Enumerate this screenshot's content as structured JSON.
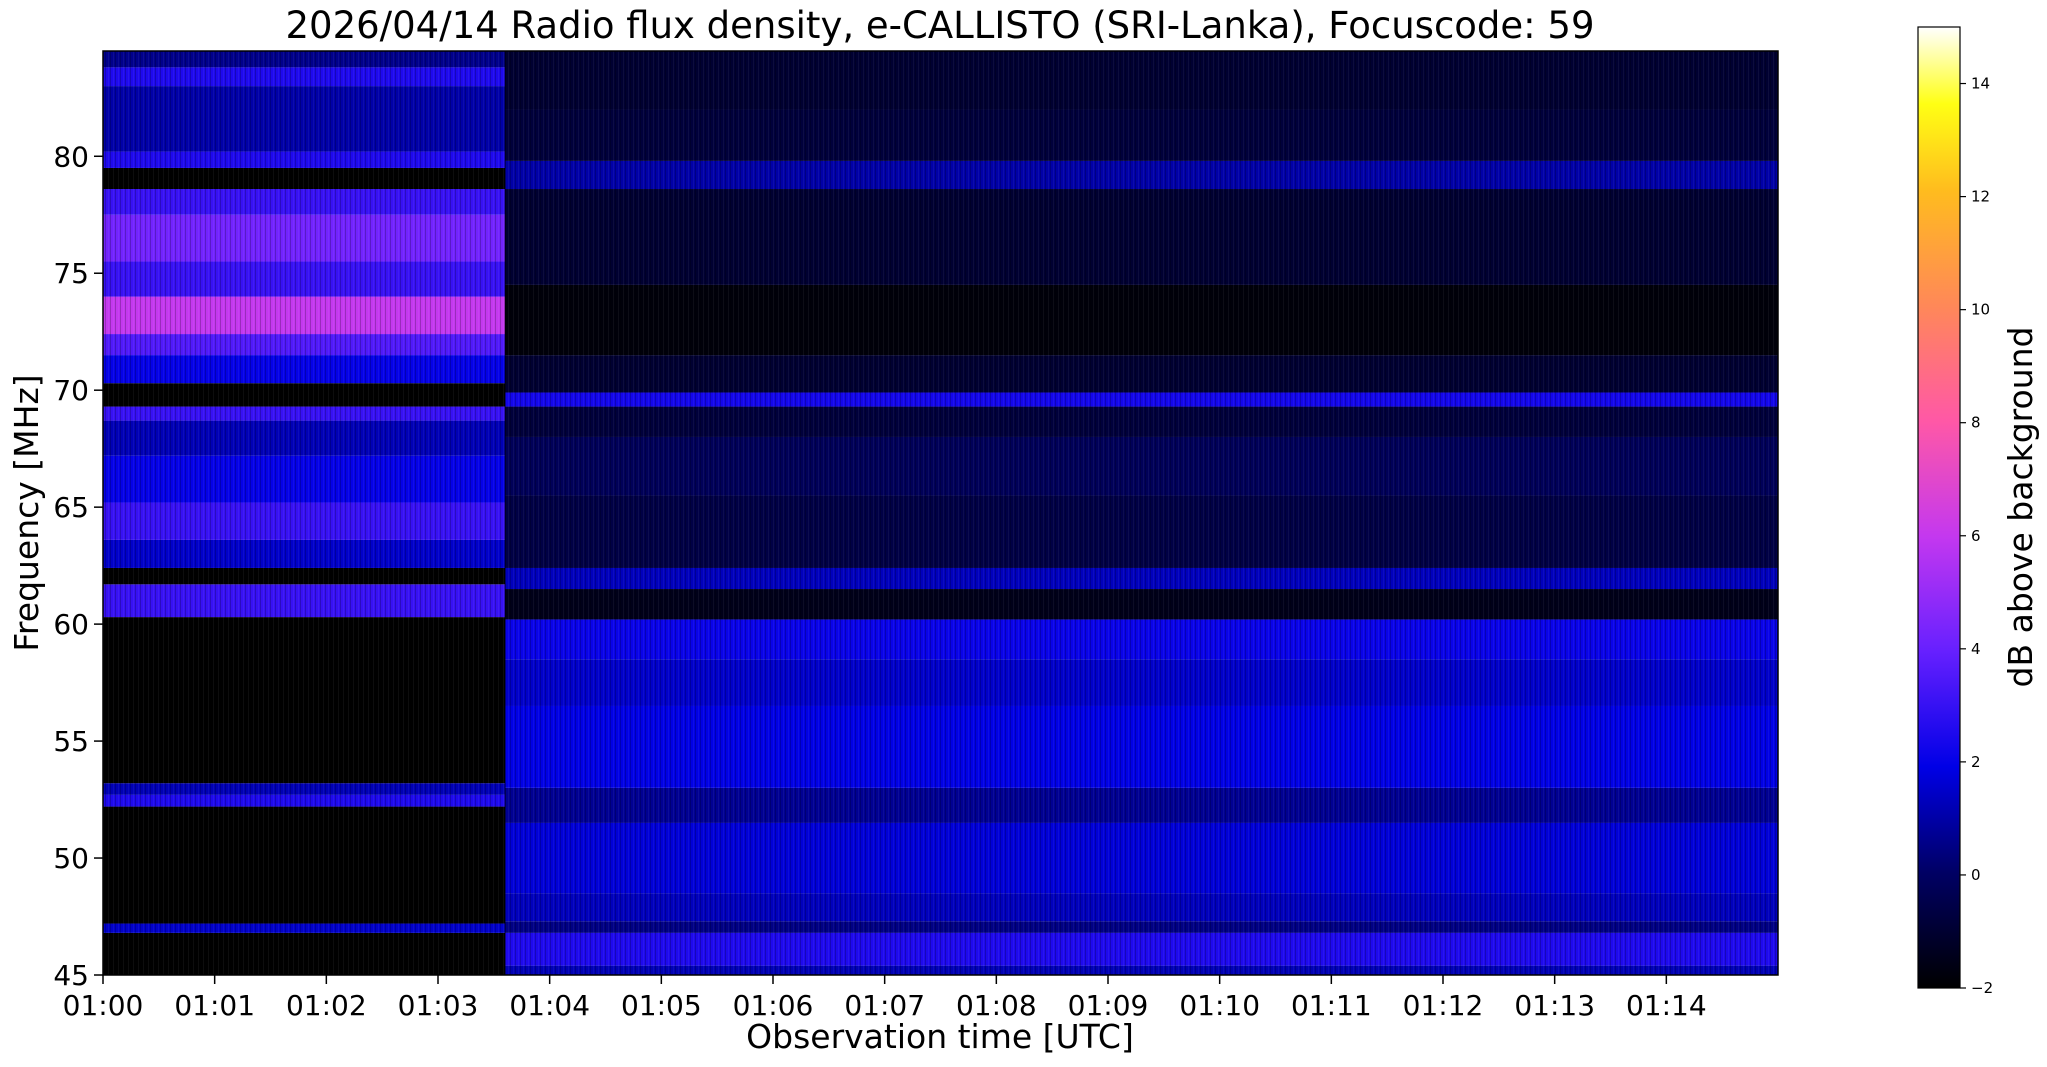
{
  "chart_data": {
    "type": "heatmap",
    "title": "2026/04/14  Radio flux density, e-CALLISTO (SRI-Lanka), Focuscode: 59",
    "xlabel": "Observation time [UTC]",
    "ylabel": "Frequency [MHz]",
    "x_tick_labels": [
      "01:00",
      "01:01",
      "01:02",
      "01:03",
      "01:04",
      "01:05",
      "01:06",
      "01:07",
      "01:08",
      "01:09",
      "01:10",
      "01:11",
      "01:12",
      "01:13",
      "01:14"
    ],
    "x_tick_minutes": [
      0,
      1,
      2,
      3,
      4,
      5,
      6,
      7,
      8,
      9,
      10,
      11,
      12,
      13,
      14
    ],
    "xlim_minutes": [
      0,
      15
    ],
    "y_ticks": [
      45,
      50,
      55,
      60,
      65,
      70,
      75,
      80
    ],
    "ylim": [
      45,
      84.5
    ],
    "colorbar": {
      "label": "dB above background",
      "ticks": [
        -2,
        0,
        2,
        4,
        6,
        8,
        10,
        12,
        14
      ],
      "range": [
        -2,
        15
      ],
      "colormap": "gnuplot2"
    },
    "segment_break_minute": 3.6,
    "regions": [
      {
        "name": "early",
        "t_start": 0.0,
        "t_end": 3.6,
        "bands": [
          {
            "f_lo": 45.0,
            "f_hi": 46.8,
            "db": -2
          },
          {
            "f_lo": 46.8,
            "f_hi": 47.2,
            "db": 1.5
          },
          {
            "f_lo": 47.2,
            "f_hi": 52.2,
            "db": -2
          },
          {
            "f_lo": 52.2,
            "f_hi": 52.7,
            "db": 2.5
          },
          {
            "f_lo": 52.7,
            "f_hi": 53.2,
            "db": 1.2
          },
          {
            "f_lo": 53.2,
            "f_hi": 60.3,
            "db": -2
          },
          {
            "f_lo": 60.3,
            "f_hi": 61.7,
            "db": 3.0
          },
          {
            "f_lo": 61.7,
            "f_hi": 62.4,
            "db": -2
          },
          {
            "f_lo": 62.4,
            "f_hi": 63.6,
            "db": 1.5
          },
          {
            "f_lo": 63.6,
            "f_hi": 65.2,
            "db": 3.0
          },
          {
            "f_lo": 65.2,
            "f_hi": 67.2,
            "db": 2.0
          },
          {
            "f_lo": 67.2,
            "f_hi": 68.7,
            "db": 1.2
          },
          {
            "f_lo": 68.7,
            "f_hi": 69.3,
            "db": 3.0
          },
          {
            "f_lo": 69.3,
            "f_hi": 70.3,
            "db": -2
          },
          {
            "f_lo": 70.3,
            "f_hi": 71.5,
            "db": 2.0
          },
          {
            "f_lo": 71.5,
            "f_hi": 72.4,
            "db": 3.5
          },
          {
            "f_lo": 72.4,
            "f_hi": 74.0,
            "db": 6.0
          },
          {
            "f_lo": 74.0,
            "f_hi": 75.5,
            "db": 3.0
          },
          {
            "f_lo": 75.5,
            "f_hi": 77.5,
            "db": 4.2
          },
          {
            "f_lo": 77.5,
            "f_hi": 78.6,
            "db": 3.0
          },
          {
            "f_lo": 78.6,
            "f_hi": 79.5,
            "db": -2
          },
          {
            "f_lo": 79.5,
            "f_hi": 80.2,
            "db": 2.5
          },
          {
            "f_lo": 80.2,
            "f_hi": 83.0,
            "db": 1.0
          },
          {
            "f_lo": 83.0,
            "f_hi": 83.8,
            "db": 2.5
          },
          {
            "f_lo": 83.8,
            "f_hi": 84.5,
            "db": 0.6
          }
        ]
      },
      {
        "name": "late",
        "t_start": 3.6,
        "t_end": 15.0,
        "bands": [
          {
            "f_lo": 45.0,
            "f_hi": 45.4,
            "db": 1.2
          },
          {
            "f_lo": 45.4,
            "f_hi": 46.8,
            "db": 2.5
          },
          {
            "f_lo": 46.8,
            "f_hi": 47.3,
            "db": 0.5
          },
          {
            "f_lo": 47.3,
            "f_hi": 48.5,
            "db": 1.3
          },
          {
            "f_lo": 48.5,
            "f_hi": 51.5,
            "db": 1.7
          },
          {
            "f_lo": 51.5,
            "f_hi": 53.0,
            "db": 0.7
          },
          {
            "f_lo": 53.0,
            "f_hi": 56.5,
            "db": 1.9
          },
          {
            "f_lo": 56.5,
            "f_hi": 58.5,
            "db": 1.5
          },
          {
            "f_lo": 58.5,
            "f_hi": 60.2,
            "db": 2.1
          },
          {
            "f_lo": 60.2,
            "f_hi": 61.5,
            "db": -1.5
          },
          {
            "f_lo": 61.5,
            "f_hi": 62.4,
            "db": 1.3
          },
          {
            "f_lo": 62.4,
            "f_hi": 65.5,
            "db": -0.6
          },
          {
            "f_lo": 65.5,
            "f_hi": 68.0,
            "db": -0.2
          },
          {
            "f_lo": 68.0,
            "f_hi": 69.3,
            "db": -0.8
          },
          {
            "f_lo": 69.3,
            "f_hi": 69.9,
            "db": 2.3
          },
          {
            "f_lo": 69.9,
            "f_hi": 71.5,
            "db": -1.0
          },
          {
            "f_lo": 71.5,
            "f_hi": 74.5,
            "db": -1.8
          },
          {
            "f_lo": 74.5,
            "f_hi": 78.6,
            "db": -1.0
          },
          {
            "f_lo": 78.6,
            "f_hi": 79.8,
            "db": 1.0
          },
          {
            "f_lo": 79.8,
            "f_hi": 82.0,
            "db": -0.8
          },
          {
            "f_lo": 82.0,
            "f_hi": 84.5,
            "db": -1.0
          }
        ]
      }
    ]
  }
}
